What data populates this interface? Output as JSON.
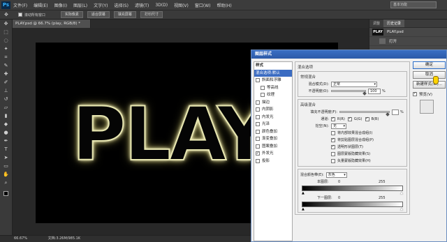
{
  "app": {
    "logo": "Ps"
  },
  "menu": [
    "文件(F)",
    "编辑(E)",
    "图像(I)",
    "图层(L)",
    "文字(Y)",
    "选择(S)",
    "滤镜(T)",
    "3D(D)",
    "视图(V)",
    "窗口(W)",
    "帮助(H)"
  ],
  "workspace": "基本功能",
  "options": {
    "scroll_all": "滚动所有窗口",
    "buttons": [
      "实际像素",
      "适合屏幕",
      "填充屏幕",
      "打印尺寸"
    ]
  },
  "document": {
    "tab": "PLAY.psd @ 66.7% (play, RGB/8) *",
    "zoom": "66.67%",
    "info": "文档:3.26M/985.1K"
  },
  "canvas": {
    "artwork_text": "PLAY"
  },
  "panels": {
    "tabs": [
      "调整",
      "历史记录"
    ],
    "history": [
      {
        "thumb": "PLAY",
        "label": "PLAY.psd"
      },
      {
        "thumb": "",
        "label": "打开"
      }
    ]
  },
  "dialog": {
    "title": "图层样式",
    "left_list": [
      {
        "label": "样式",
        "type": "head"
      },
      {
        "label": "混合选项:默认",
        "type": "selected"
      },
      {
        "label": "斜面和浮雕",
        "type": "check",
        "checked": false
      },
      {
        "label": "等高线",
        "type": "sub",
        "checked": false
      },
      {
        "label": "纹理",
        "type": "sub",
        "checked": false
      },
      {
        "label": "描边",
        "type": "check",
        "checked": false
      },
      {
        "label": "内阴影",
        "type": "check",
        "checked": false
      },
      {
        "label": "内发光",
        "type": "check",
        "checked": false
      },
      {
        "label": "光泽",
        "type": "check",
        "checked": false
      },
      {
        "label": "颜色叠加",
        "type": "check",
        "checked": false
      },
      {
        "label": "渐变叠加",
        "type": "check",
        "checked": false
      },
      {
        "label": "图案叠加",
        "type": "check",
        "checked": false
      },
      {
        "label": "外发光",
        "type": "check",
        "checked": true
      },
      {
        "label": "投影",
        "type": "check",
        "checked": false
      }
    ],
    "general": {
      "section": "混合选项",
      "group": "常规混合",
      "mode_label": "混合模式(D):",
      "mode_value": "正常",
      "opacity_label": "不透明度(O):",
      "opacity_value": "100",
      "opacity_unit": "%"
    },
    "advanced": {
      "group": "高级混合",
      "fill_label": "填充不透明度(F):",
      "fill_unit": "%",
      "channels_label": "通道:",
      "channels": [
        "R(R)",
        "G(G)",
        "B(B)"
      ],
      "knockout_label": "挖空(N):",
      "knockout_value": "无",
      "options": [
        {
          "label": "将内部效果混合成组(I)",
          "checked": false
        },
        {
          "label": "将剪贴图层混合成组(P)",
          "checked": true
        },
        {
          "label": "透明形状图层(T)",
          "checked": true
        },
        {
          "label": "图层蒙版隐藏效果(S)",
          "checked": false
        },
        {
          "label": "矢量蒙版隐藏效果(H)",
          "checked": false
        }
      ]
    },
    "blend_if": {
      "label": "混合颜色带(E):",
      "value": "灰色",
      "this_layer": "本图层:",
      "under_layer": "下一图层:",
      "min": "0",
      "max": "255"
    },
    "buttons": {
      "ok": "确定",
      "cancel": "取消",
      "new_style": "新建样式(W)...",
      "preview": "预览(V)"
    }
  }
}
